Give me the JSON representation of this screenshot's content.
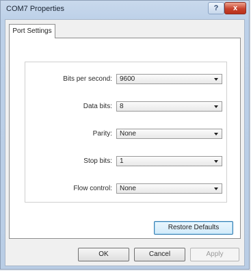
{
  "window": {
    "title": "COM7 Properties",
    "help_glyph": "?",
    "close_glyph": "x"
  },
  "tabs": [
    {
      "label": "Port Settings",
      "selected": true
    }
  ],
  "settings": [
    {
      "label": "Bits per second:",
      "value": "9600"
    },
    {
      "label": "Data bits:",
      "value": "8"
    },
    {
      "label": "Parity:",
      "value": "None"
    },
    {
      "label": "Stop bits:",
      "value": "1"
    },
    {
      "label": "Flow control:",
      "value": "None"
    }
  ],
  "buttons": {
    "restore_defaults": "Restore Defaults",
    "ok": "OK",
    "cancel": "Cancel",
    "apply": "Apply"
  },
  "colors": {
    "titlebar": "#bcd0e8",
    "close_button": "#c8432d",
    "focused_button_border": "#3c7fb1"
  }
}
